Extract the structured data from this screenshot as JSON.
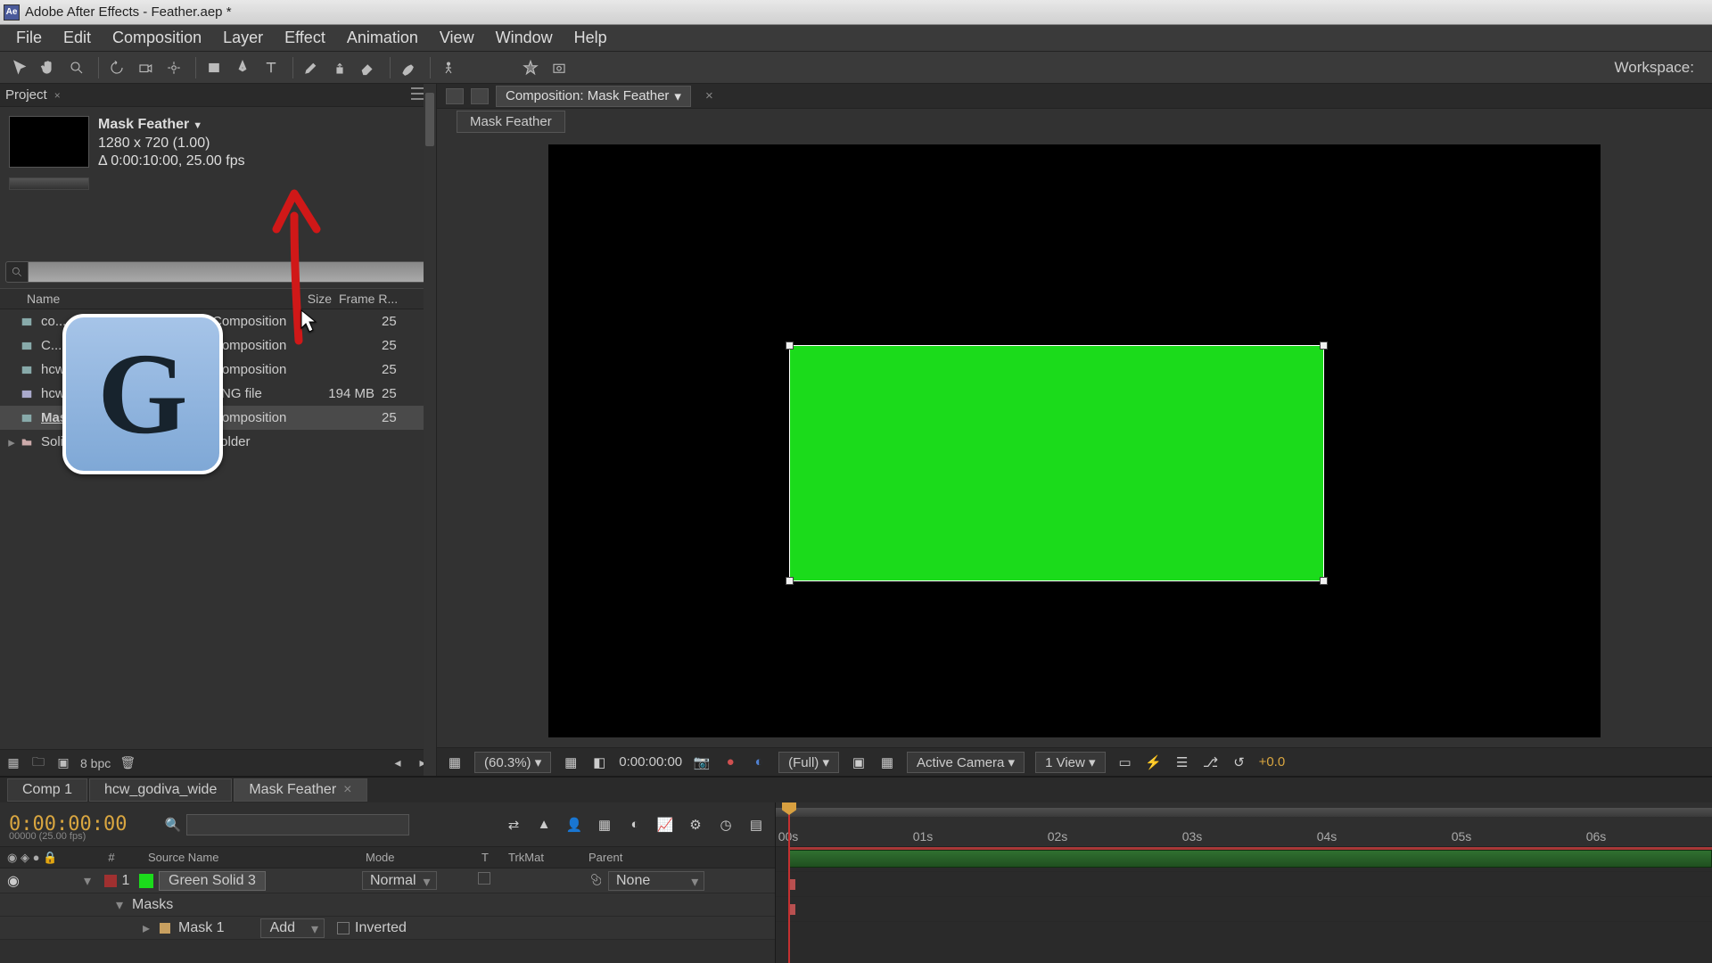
{
  "title_bar": "Adobe After Effects - Feather.aep *",
  "app_icon_text": "Ae",
  "menu": {
    "file": "File",
    "edit": "Edit",
    "composition": "Composition",
    "layer": "Layer",
    "effect": "Effect",
    "animation": "Animation",
    "view": "View",
    "window": "Window",
    "help": "Help"
  },
  "toolbar": {
    "workspace_label": "Workspace:"
  },
  "project": {
    "tab": "Project",
    "comp_name": "Mask Feather",
    "comp_dims": "1280 x 720 (1.00)",
    "comp_dur": "Δ 0:00:10:00, 25.00 fps",
    "search_placeholder": "",
    "headers": {
      "name": "Name",
      "type": "",
      "size": "Size",
      "frame": "Frame R..."
    },
    "items": [
      {
        "name": "co...",
        "type": "Composition",
        "size": "",
        "fr": "25"
      },
      {
        "name": "C...",
        "type": "Composition",
        "size": "",
        "fr": "25"
      },
      {
        "name": "hcw_god...wide",
        "type": "Composition",
        "size": "",
        "fr": "25"
      },
      {
        "name": "hcw_god....png",
        "type": "PNG file",
        "size": "194 MB",
        "fr": "25"
      },
      {
        "name": "Mask Feather",
        "type": "Composition",
        "size": "",
        "fr": "25"
      },
      {
        "name": "Solids",
        "type": "Folder",
        "size": "",
        "fr": ""
      }
    ],
    "footer_bpc": "8 bpc"
  },
  "key_overlay": "G",
  "viewer": {
    "comp_chip": "Composition: Mask Feather",
    "subtab": "Mask Feather",
    "footer": {
      "zoom": "(60.3%)",
      "timecode": "0:00:00:00",
      "res": "(Full)",
      "camera": "Active Camera",
      "views": "1 View",
      "exposure": "+0.0"
    }
  },
  "timeline": {
    "tabs": [
      {
        "label": "Comp 1"
      },
      {
        "label": "hcw_godiva_wide"
      },
      {
        "label": "Mask Feather"
      }
    ],
    "timecode": "0:00:00:00",
    "timecode_sub": "00000 (25.00 fps)",
    "headers": {
      "num": "#",
      "source": "Source Name",
      "mode": "Mode",
      "t": "T",
      "trkmat": "TrkMat",
      "parent": "Parent"
    },
    "layer": {
      "num": "1",
      "name": "Green Solid 3",
      "mode": "Normal",
      "parent": "None"
    },
    "masks_label": "Masks",
    "mask1": "Mask 1",
    "mask_mode": "Add",
    "inverted": "Inverted",
    "ruler": [
      "00s",
      "01s",
      "02s",
      "03s",
      "04s",
      "05s",
      "06s"
    ]
  }
}
